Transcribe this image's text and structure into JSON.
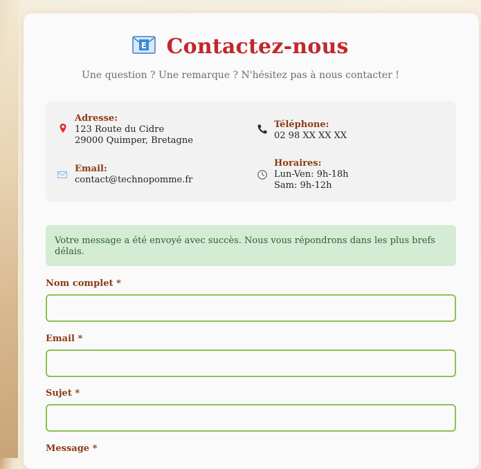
{
  "header": {
    "title": "Contactez-nous",
    "subtitle": "Une question ? Une remarque ? N'hésitez pas à nous contacter !",
    "icon": "envelope-icon"
  },
  "contact_info": {
    "address": {
      "label": "Adresse:",
      "line1": "123 Route du Cidre",
      "line2": "29000 Quimper, Bretagne",
      "icon": "map-pin-icon"
    },
    "phone": {
      "label": "Téléphone:",
      "value": "02 98 XX XX XX",
      "icon": "phone-icon"
    },
    "email": {
      "label": "Email:",
      "value": "contact@technopomme.fr",
      "icon": "envelope-icon"
    },
    "hours": {
      "label": "Horaires:",
      "line1": "Lun-Ven: 9h-18h",
      "line2": "Sam: 9h-12h",
      "icon": "clock-icon"
    }
  },
  "alert": {
    "message": "Votre message a été envoyé avec succès. Nous vous répondrons dans les plus brefs délais."
  },
  "form": {
    "name_label": "Nom complet *",
    "name_value": "",
    "email_label": "Email *",
    "email_value": "",
    "subject_label": "Sujet *",
    "subject_value": "",
    "message_label": "Message *"
  },
  "colors": {
    "title": "#c0272d",
    "label": "#8b3a12",
    "input_border": "#8cc152",
    "success_bg": "#d4ebd4",
    "success_text": "#2c5f2e"
  }
}
